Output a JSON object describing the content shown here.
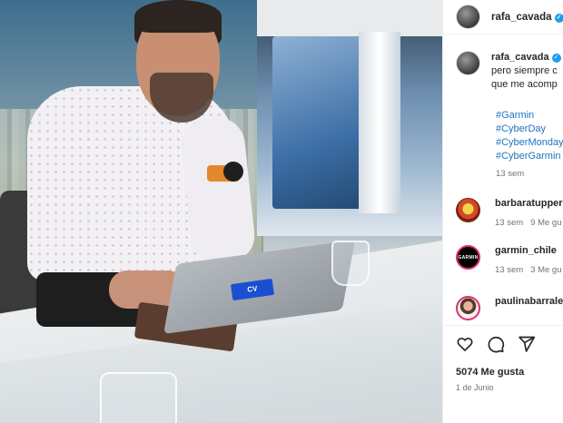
{
  "post": {
    "username": "rafa_cavada",
    "image_badge": "CV"
  },
  "caption": {
    "username": "rafa_cavada",
    "line1": "pero siempre c",
    "line2": "que me acomp",
    "hashtags": [
      "#Garmin",
      "#CyberDay",
      "#CyberMonday",
      "#CyberGarmin"
    ],
    "age": "13 sem"
  },
  "comments": [
    {
      "username": "barbaratupper",
      "age": "13 sem",
      "likes": "9 Me gu"
    },
    {
      "username": "garmin_chile",
      "age": "13 sem",
      "likes": "3 Me gu",
      "avatar_text": "GARMIN"
    },
    {
      "username": "paulinabarrale",
      "age": "",
      "likes": ""
    }
  ],
  "actions": {
    "icons": [
      "heart-icon",
      "comment-icon",
      "share-icon"
    ],
    "likes_label": "5074 Me gusta",
    "date": "1 de Junio"
  },
  "colors": {
    "verified": "#1d9bf0",
    "hashtag": "#1e73be",
    "story_ring": "#e1306c"
  }
}
